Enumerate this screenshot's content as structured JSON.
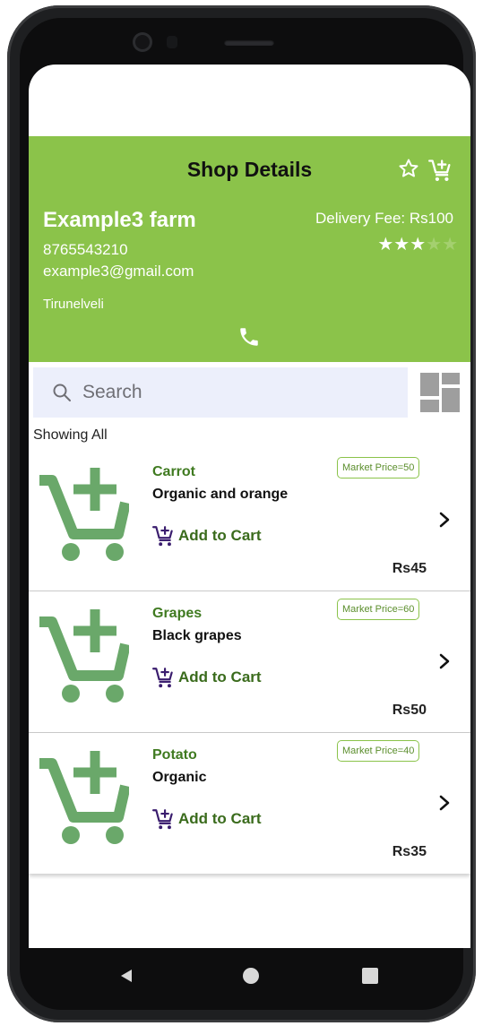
{
  "header": {
    "title": "Shop Details",
    "favorite_icon": "star-outline-icon",
    "cart_icon": "cart-add-icon",
    "background": "#8bc34a"
  },
  "shop": {
    "name": "Example3 farm",
    "phone": "8765543210",
    "email": "example3@gmail.com",
    "city": "Tirunelveli",
    "delivery_fee": "Delivery Fee: Rs100",
    "rating": 3,
    "rating_max": 5,
    "call_icon": "phone-icon"
  },
  "search": {
    "placeholder": "Search",
    "value": ""
  },
  "filter": {
    "label": "Showing All"
  },
  "products": [
    {
      "name": "Carrot",
      "description": "Organic and orange",
      "add_to_cart": "Add to Cart",
      "market_price": "Market Price=50",
      "price": "Rs45"
    },
    {
      "name": "Grapes",
      "description": "Black grapes",
      "add_to_cart": "Add to Cart",
      "market_price": "Market Price=60",
      "price": "Rs50"
    },
    {
      "name": "Potato",
      "description": "Organic",
      "add_to_cart": "Add to Cart",
      "market_price": "Market Price=40",
      "price": "Rs35"
    }
  ],
  "colors": {
    "accent_green": "#8bc34a",
    "cart_icon_green": "#6aa86a",
    "add_cart_purple": "#3a1d6e"
  }
}
